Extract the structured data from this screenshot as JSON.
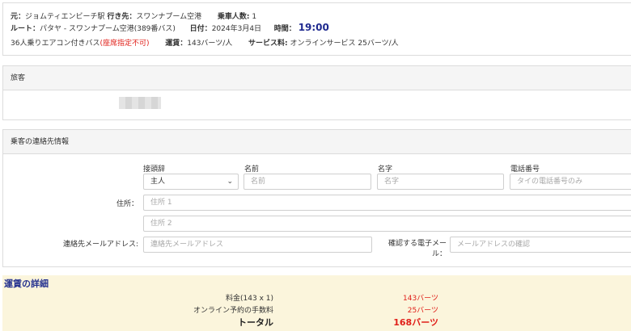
{
  "trip": {
    "from_label": "元：",
    "from_value": "ジョムティエンビーチ駅",
    "to_label": "行き先：",
    "to_value": "スワンナプーム空港",
    "passengers_label": "乗車人数:",
    "passengers_value": "1",
    "route_label": "ルート：",
    "route_value": "パタヤ - スワンナプーム空港(389番バス)",
    "date_label": "日付：",
    "date_value": "2024年3月4日",
    "time_label": "時間：",
    "time_value": "19:00",
    "bus_type": "36人乗りエアコン付きバス",
    "seat_note": "(座席指定不可)",
    "fare_label": "運賃：",
    "fare_value": "143バーツ/人",
    "service_label": "サービス料:",
    "service_value": "オンラインサービス 25バーツ/人"
  },
  "passenger": {
    "section_title": "旅客"
  },
  "contact": {
    "section_title": "乗客の連絡先情報",
    "title_label": "接頭辞",
    "title_value": "主人",
    "name_label": "名前",
    "name_placeholder": "名前",
    "surname_label": "名字",
    "surname_placeholder": "名字",
    "phone_label": "電話番号",
    "phone_placeholder": "タイの電話番号のみ",
    "address_label": "住所：",
    "address1_placeholder": "住所 1",
    "address2_placeholder": "住所 2",
    "email_label": "連絡先メールアドレス:",
    "email_placeholder": "連絡先メールアドレス",
    "confirm_label_1": "確認する電子メー",
    "confirm_label_2": "ル：",
    "confirm_placeholder": "メールアドレスの確認"
  },
  "fare": {
    "title": "運賃の詳細",
    "rows": [
      {
        "label": "料金(143 x 1)",
        "value": "143バーツ"
      },
      {
        "label": "オンライン予約の手数料",
        "value": "25バーツ"
      }
    ],
    "total_label": "トータル",
    "total_value": "168バーツ"
  }
}
